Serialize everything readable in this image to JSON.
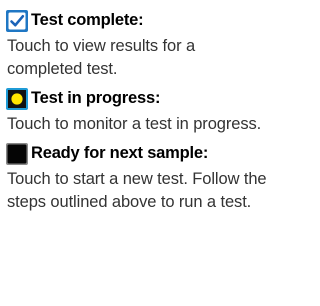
{
  "legend": {
    "items": [
      {
        "icon": "checkbox-checked-icon",
        "title": "Test complete:",
        "description": "Touch to view results for a completed test.",
        "colors": {
          "frame": "#1f77c4",
          "fill": "#ffffff",
          "check": "#1a63b8"
        }
      },
      {
        "icon": "yellow-circle-icon",
        "title": "Test in progress:",
        "description": "Touch to monitor a test in progress.",
        "colors": {
          "frame": "#1f9bd6",
          "fill": "#111111",
          "dot": "#ffe600"
        }
      },
      {
        "icon": "black-square-icon",
        "title": "Ready for next sample:",
        "description": "Touch to start a new test. Follow the steps outlined above to run a test.",
        "colors": {
          "frame": "#888888",
          "fill": "#050505"
        }
      }
    ]
  }
}
